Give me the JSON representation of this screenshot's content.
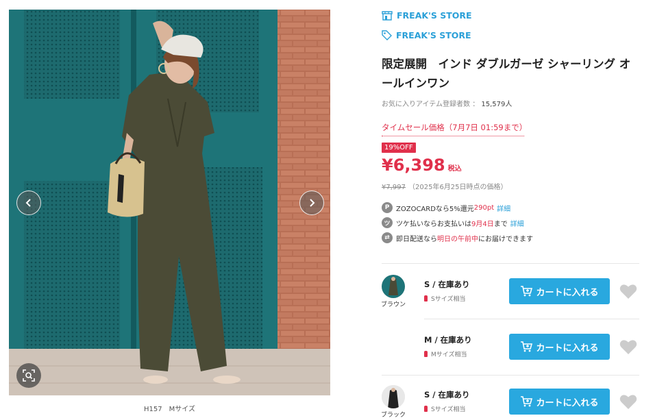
{
  "gallery": {
    "caption": "H157　Mサイズ",
    "icons": {
      "prev": "chevron-left-icon",
      "next": "chevron-right-icon",
      "zoom": "zoom-scan-icon"
    }
  },
  "shop": {
    "brand_label": "FREAK'S STORE",
    "tag_label": "FREAK'S STORE",
    "icons": {
      "brand": "store-icon",
      "tag": "tag-icon"
    }
  },
  "product": {
    "title": "限定展開　インド ダブルガーゼ シャーリング オールインワン",
    "favorite_label": "お気に入りアイテム登録者数",
    "favorite_sep": "：",
    "favorite_count": "15,579人"
  },
  "pricing": {
    "sale_label": "タイムセール価格（7月7日 01:59まで）",
    "discount_badge": "19%OFF",
    "price": "¥6,398",
    "tax_label": "税込",
    "original_price": "¥7,997",
    "original_note": "（2025年6月25日時点の価格）"
  },
  "perks": [
    {
      "icon": "P",
      "icon_name": "zozocard-icon",
      "pre": "ZOZOCARDなら5%還元",
      "highlight": "290pt",
      "post": "",
      "link": "詳細"
    },
    {
      "icon": "ツ",
      "icon_name": "tsuke-barai-icon",
      "pre": "ツケ払いならお支払いは",
      "highlight": "9月4日",
      "post": "まで",
      "link": "詳細"
    },
    {
      "icon": "⇄",
      "icon_name": "delivery-truck-icon",
      "pre": "即日配送なら",
      "highlight": "明日の午前中",
      "post": "にお届けできます",
      "link": ""
    }
  ],
  "variants": [
    {
      "color": "ブラウン",
      "size_stock": "S / 在庫あり",
      "fit": "Sサイズ相当",
      "cart_label": "カートに入れる",
      "swatch_color": "#4a4a36"
    },
    {
      "color": "",
      "size_stock": "M / 在庫あり",
      "fit": "Mサイズ相当",
      "cart_label": "カートに入れる",
      "swatch_color": ""
    },
    {
      "color": "ブラック",
      "size_stock": "S / 在庫あり",
      "fit": "Sサイズ相当",
      "cart_label": "カートに入れる",
      "swatch_color": "#222222"
    }
  ],
  "colors": {
    "accent_blue": "#2ba0d8",
    "cart_blue": "#29a8df",
    "sale_red": "#e0304b",
    "heart_gray": "#cccccc"
  }
}
